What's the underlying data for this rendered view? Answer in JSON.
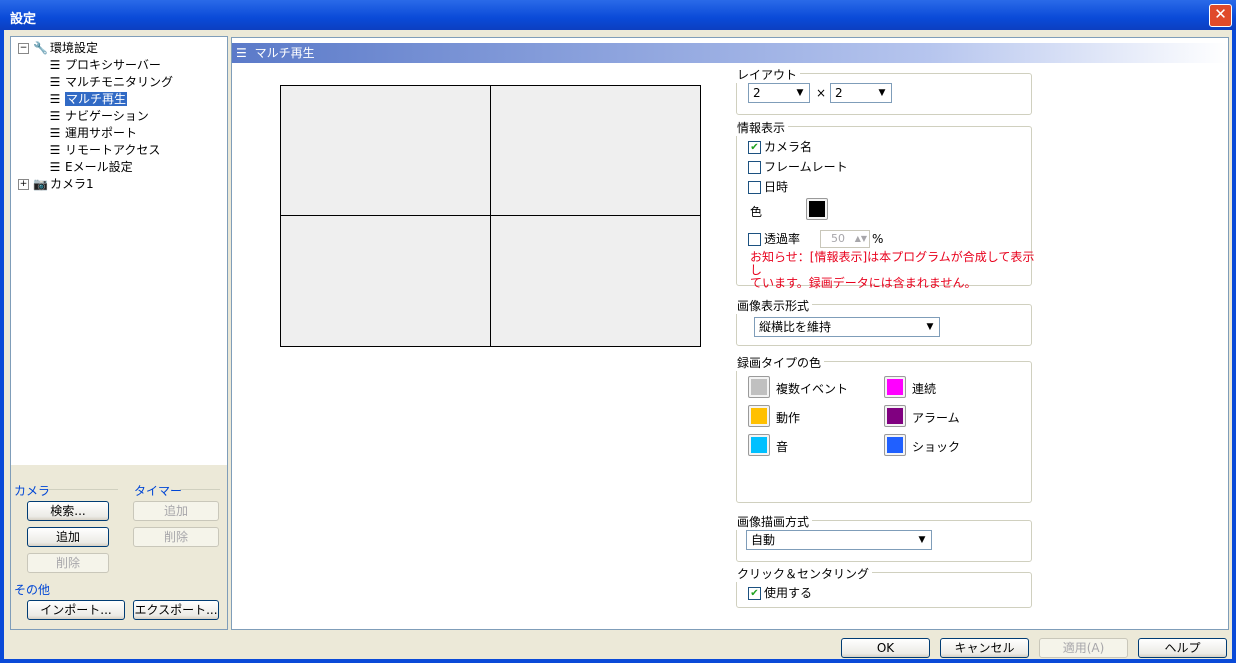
{
  "window": {
    "title": "設定",
    "close_glyph": "✕"
  },
  "tree": {
    "root_label": "環境設定",
    "items": [
      "プロキシサーバー",
      "マルチモニタリング",
      "マルチ再生",
      "ナビゲーション",
      "運用サポート",
      "リモートアクセス",
      "Eメール設定"
    ],
    "selected": "マルチ再生",
    "camera_label": "カメラ1"
  },
  "left_buttons": {
    "camera_group": "カメラ",
    "timer_group": "タイマー",
    "search": "検索...",
    "add": "追加",
    "delete": "削除",
    "timer_add": "追加",
    "timer_delete": "削除",
    "other_group": "その他",
    "import": "インポート...",
    "export": "エクスポート..."
  },
  "main": {
    "header": "マルチ再生",
    "layout": {
      "label": "レイアウト",
      "cols": "2",
      "times": "×",
      "rows": "2"
    },
    "info": {
      "label": "情報表示",
      "camera_name": "カメラ名",
      "camera_name_checked": true,
      "frame_rate": "フレームレート",
      "frame_rate_checked": false,
      "datetime": "日時",
      "datetime_checked": false,
      "color_label": "色",
      "color": "#000000",
      "transparency": "透過率",
      "transparency_checked": false,
      "transparency_value": "50",
      "transparency_unit": "%",
      "notice_line1": "お知らせ：[情報表示]は本プログラムが合成して表示し",
      "notice_line2": "ています。録画データには含まれません。"
    },
    "image_format": {
      "label": "画像表示形式",
      "value": "縦横比を維持"
    },
    "record_colors": {
      "label": "録画タイプの色",
      "items": [
        {
          "name": "複数イベント",
          "color": "#c0c0c0"
        },
        {
          "name": "連続",
          "color": "#ff00ff"
        },
        {
          "name": "動作",
          "color": "#ffc000"
        },
        {
          "name": "アラーム",
          "color": "#800080"
        },
        {
          "name": "音",
          "color": "#00c0ff"
        },
        {
          "name": "ショック",
          "color": "#2060ff"
        }
      ]
    },
    "render_mode": {
      "label": "画像描画方式",
      "value": "自動"
    },
    "click_center": {
      "label": "クリック＆センタリング",
      "use": "使用する",
      "use_checked": true
    }
  },
  "footer": {
    "ok": "OK",
    "cancel": "キャンセル",
    "apply": "適用(A)",
    "help": "ヘルプ"
  }
}
